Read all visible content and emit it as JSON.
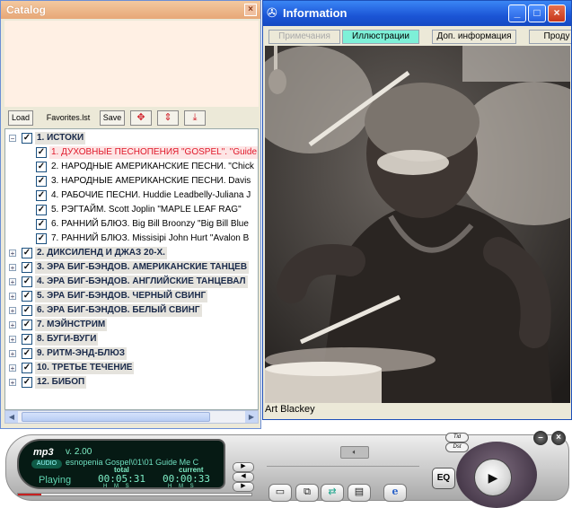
{
  "catalog": {
    "title": "Catalog",
    "close_symbol": "×",
    "toolbar": {
      "load_label": "Load",
      "playlist_label": "Favorites.lst",
      "save_label": "Save"
    },
    "tree": [
      {
        "label": "1. ИСТОКИ",
        "expanded": true,
        "children": [
          {
            "label": "1. ДУХОВНЫЕ ПЕСНОПЕНИЯ \"GOSPEL\". \"Guide",
            "active": true
          },
          {
            "label": "2. НАРОДНЫЕ АМЕРИКАНСКИЕ ПЕСНИ. \"Chick"
          },
          {
            "label": "3. НАРОДНЫЕ АМЕРИКАНСКИЕ ПЕСНИ. Davis"
          },
          {
            "label": "4. РАБОЧИЕ ПЕСНИ. Huddie Leadbelly-Juliana J"
          },
          {
            "label": "5. РЭГТАЙМ. Scott Joplin \"MAPLE LEAF RAG\""
          },
          {
            "label": "6. РАННИЙ БЛЮЗ. Big Bill Broonzy \"Big Bill Blue"
          },
          {
            "label": "7. РАННИЙ БЛЮЗ. Missisipi John Hurt \"Avalon B"
          }
        ]
      },
      {
        "label": "2. ДИКСИЛЕНД И ДЖАЗ 20-Х."
      },
      {
        "label": "3. ЭРА БИГ-БЭНДОВ. АМЕРИКАНСКИЕ ТАНЦЕВ"
      },
      {
        "label": "4. ЭРА БИГ-БЭНДОВ. АНГЛИЙСКИЕ ТАНЦЕВАЛ"
      },
      {
        "label": "5. ЭРА БИГ-БЭНДОВ. ЧЕРНЫЙ СВИНГ"
      },
      {
        "label": "6. ЭРА БИГ-БЭНДОВ. БЕЛЫЙ СВИНГ"
      },
      {
        "label": "7. МЭЙНСТРИМ"
      },
      {
        "label": "8. БУГИ-ВУГИ"
      },
      {
        "label": "9. РИТМ-ЭНД-БЛЮЗ"
      },
      {
        "label": "10. ТРЕТЬЕ ТЕЧЕНИЕ"
      },
      {
        "label": "12. БИБОП"
      }
    ]
  },
  "info": {
    "title": "Information",
    "tabs": [
      {
        "label": "Примечания",
        "state": "disabled"
      },
      {
        "label": "Иллюстрации",
        "state": "selected"
      },
      {
        "label": "Доп. информация",
        "state": "normal"
      },
      {
        "label": "Проду",
        "state": "normal"
      }
    ],
    "caption": "Art Blackey"
  },
  "player": {
    "logo": "mp3",
    "version": "v. 2.00",
    "badge": "AUDIO",
    "track": "esnopenia Gospel\\01\\01 Guide Me C",
    "state": "Playing",
    "total_label": "total",
    "current_label": "current",
    "total_time": "00:05:31",
    "current_time": "00:00:33",
    "hms": "H M S",
    "eq_label": "EQ",
    "pill_top": "Tid",
    "pill_bottom": "Dst",
    "progress": 0.1
  },
  "colors": {
    "catalog_title": "#e7a777",
    "info_title": "#1b55d6",
    "active_item": "#e0182a",
    "tab_selected": "#7ef0d8",
    "lcd_text": "#7ff0c8"
  }
}
